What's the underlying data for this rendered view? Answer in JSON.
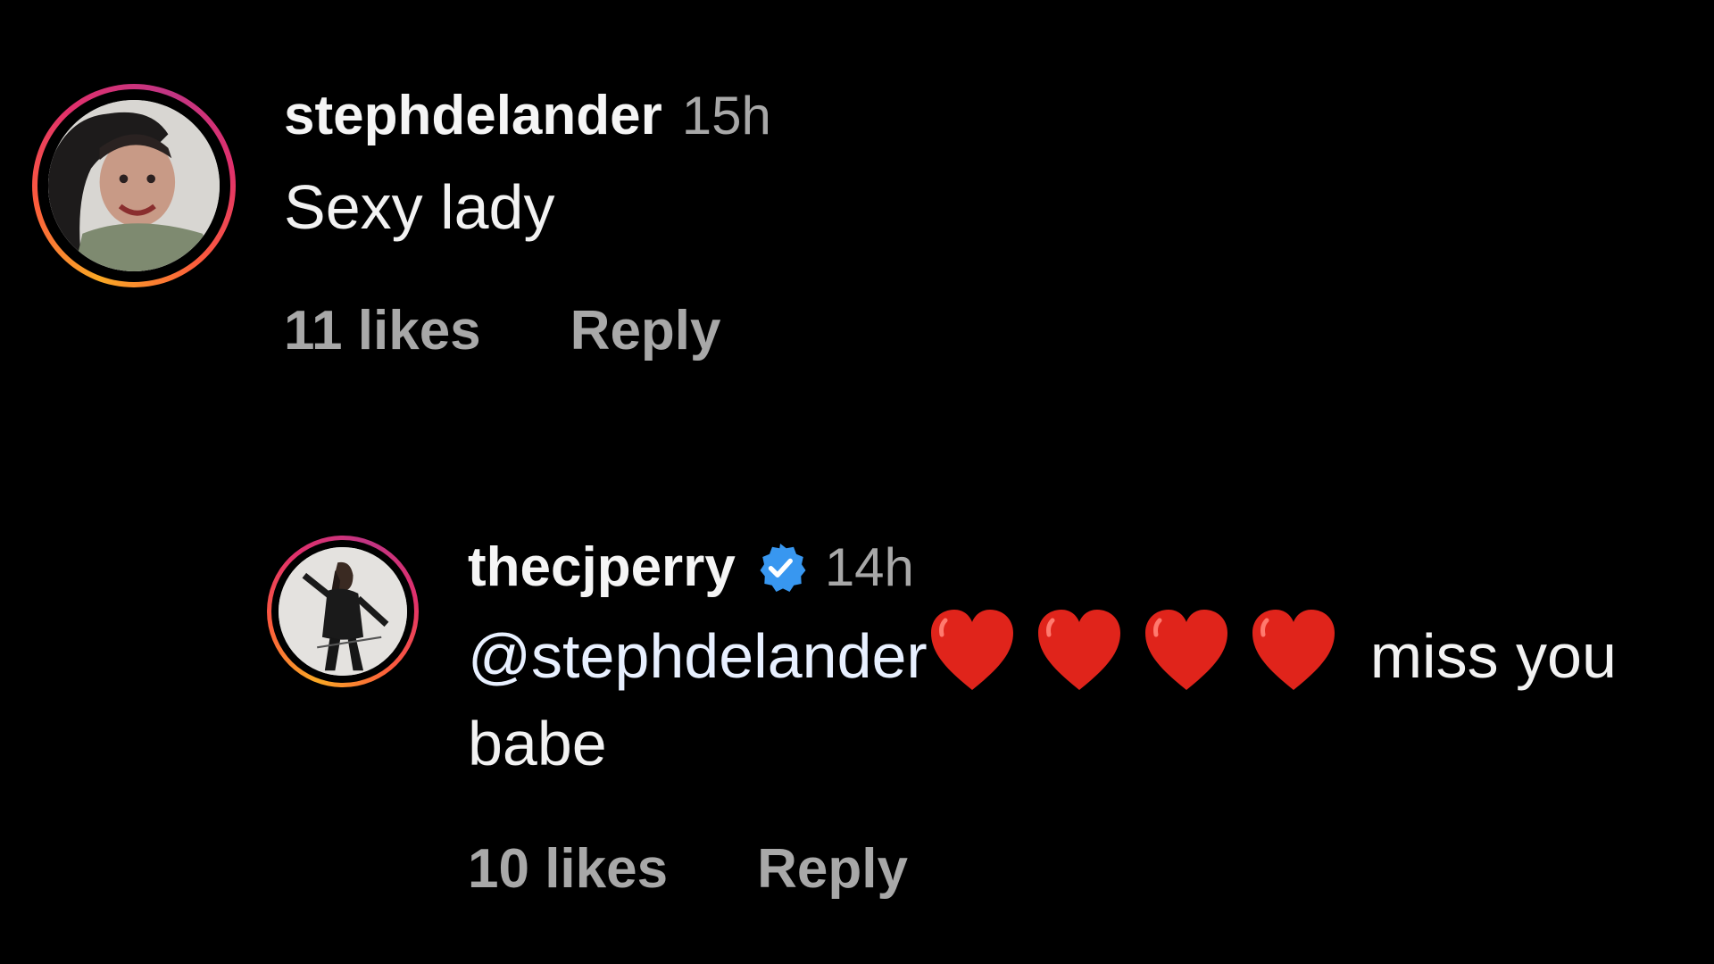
{
  "comments": [
    {
      "username": "stephdelander",
      "time": "15h",
      "text": "Sexy lady",
      "likes": "11 likes",
      "reply_label": "Reply",
      "avatar_icon": "profile-photo"
    },
    {
      "username": "thecjperry",
      "verified": true,
      "time": "14h",
      "mention": "@stephdelander",
      "hearts": [
        "❤️",
        "❤️",
        "❤️",
        "❤️"
      ],
      "text_after": "miss you babe",
      "likes": "10 likes",
      "reply_label": "Reply",
      "avatar_icon": "profile-photo"
    }
  ],
  "colors": {
    "background": "#000000",
    "text": "#f2f2f2",
    "muted": "#a8a8a8",
    "verified_badge": "#3897f0",
    "heart": "#e0241b",
    "story_ring_start": "#f9a825",
    "story_ring_end": "#c13584"
  }
}
